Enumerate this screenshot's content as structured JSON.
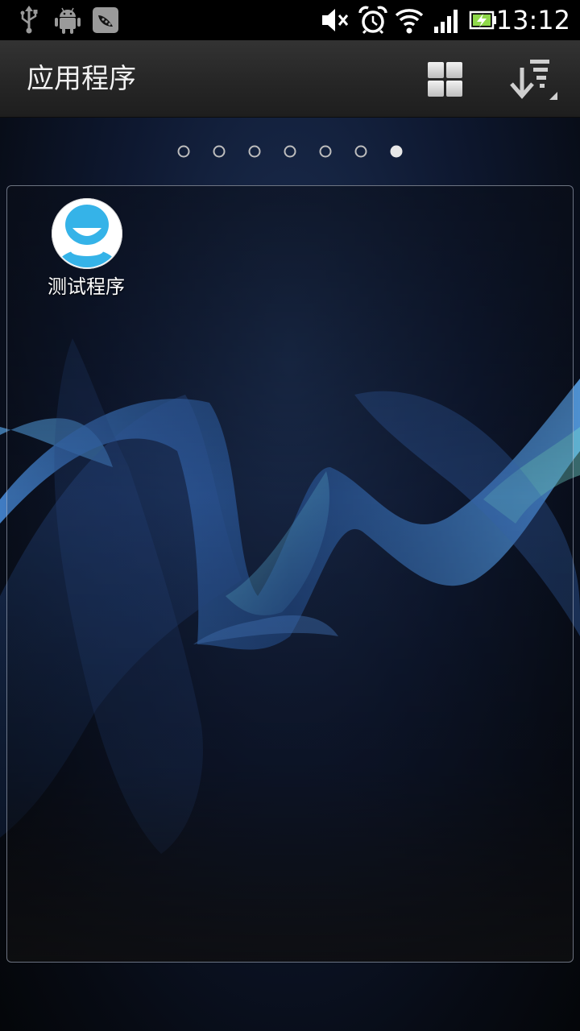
{
  "status_bar": {
    "time": "13:12",
    "icons": [
      "usb-icon",
      "android-debug-icon",
      "app-notification-icon",
      "mute-icon",
      "alarm-icon",
      "wifi-icon",
      "signal-icon",
      "battery-charging-icon"
    ]
  },
  "action_bar": {
    "title": "应用程序",
    "actions": [
      "grid-view-icon",
      "sort-icon"
    ]
  },
  "pager": {
    "page_count": 7,
    "current_page": 7
  },
  "apps": [
    {
      "label": "测试程序",
      "icon": "smiley-face-icon"
    }
  ],
  "colors": {
    "accent_blue": "#35b3e8",
    "status_bar": "#000000",
    "action_bar": "#2a2a2a"
  }
}
